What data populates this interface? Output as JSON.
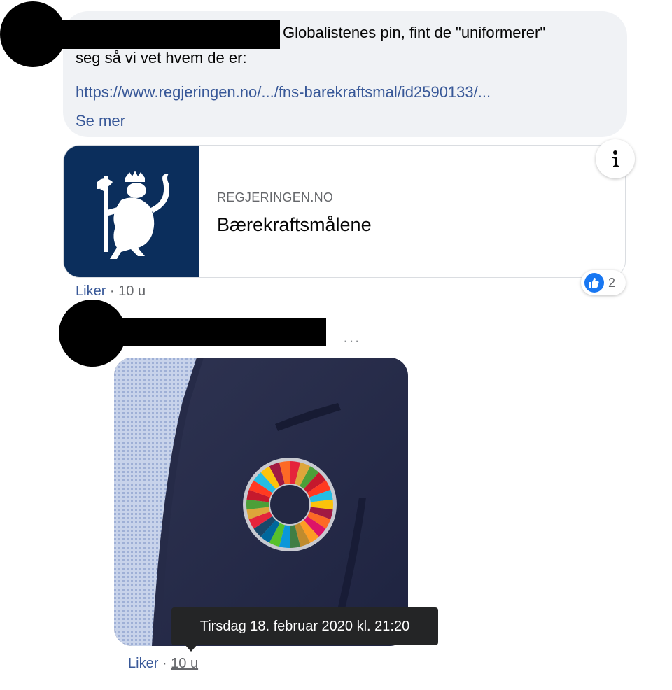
{
  "comments": [
    {
      "text_line1": "Globalistenes pin, fint de \"uniformerer\"",
      "text_line2": "seg så vi vet hvem de er:",
      "link_text": "https://www.regjeringen.no/.../fns-barekraftsmal/id2590133/...",
      "see_more": "Se mer",
      "preview": {
        "domain": "REGJERINGEN.NO",
        "title": "Bærekraftsmålene",
        "info_icon": "info-icon",
        "thumbnail": "norwegian-coat-of-arms"
      },
      "reactions": {
        "icon": "like-icon",
        "count": "2"
      },
      "like_label": "Liker",
      "separator": "·",
      "time": "10 u"
    },
    {
      "more_icon": "more-horizontal-icon",
      "more_text": "···",
      "photo": "sdg-color-wheel-lapel-pin-on-navy-jacket",
      "tooltip": "Tirsdag 18. februar 2020 kl. 21:20",
      "like_label": "Liker",
      "separator": "·",
      "time": "10 u"
    }
  ],
  "colors": {
    "bubble": "#f0f2f5",
    "link": "#385898",
    "meta": "#65676b",
    "coat_of_arms_bg": "#0b2e5c",
    "like_blue": "#1877f2",
    "tooltip_bg": "#242526"
  }
}
